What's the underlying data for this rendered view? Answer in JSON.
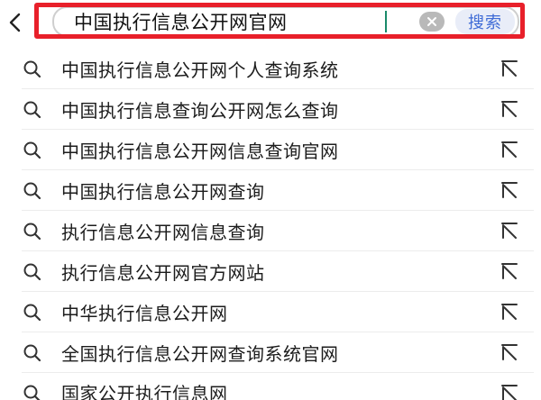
{
  "search": {
    "query": "中国执行信息公开网官网",
    "submit_label": "搜索"
  },
  "suggestions": [
    "中国执行信息公开网个人查询系统",
    "中国执行信息查询公开网怎么查询",
    "中国执行信息公开网信息查询官网",
    "中国执行信息公开网查询",
    "执行信息公开网信息查询",
    "执行信息公开网官方网站",
    "中华执行信息公开网",
    "全国执行信息公开网查询系统官网",
    "国家公开执行信息网"
  ],
  "icons": {
    "back": "chevron-left-icon",
    "clear": "clear-icon",
    "suggestion": "search-icon",
    "fill": "arrow-up-left-icon"
  },
  "colors": {
    "highlight_frame": "#e8202a",
    "search_button_text": "#3f6bd6",
    "search_button_bg": "#e9edf8",
    "caret": "#1a8a6a"
  }
}
